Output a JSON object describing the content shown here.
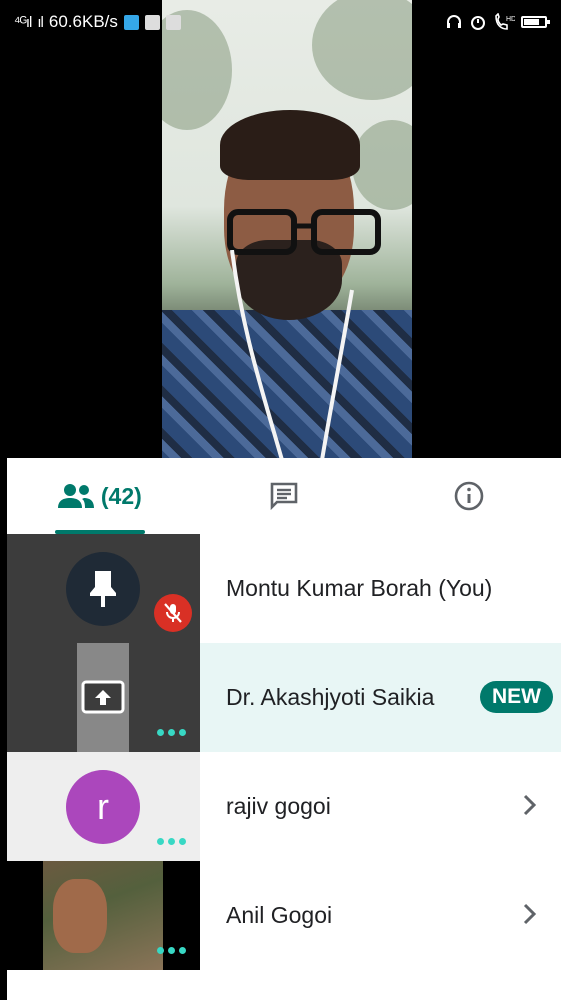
{
  "status_bar": {
    "signal_1": "⁴ᴳıl",
    "signal_2": "ıl",
    "speed": "60.6KB/s"
  },
  "tabs": {
    "people_count": "(42)",
    "items": [
      {
        "icon": "people-icon"
      },
      {
        "icon": "chat-icon"
      },
      {
        "icon": "info-icon"
      }
    ]
  },
  "participants": [
    {
      "name": "Montu Kumar Borah (You)",
      "muted": true
    },
    {
      "name": "Dr. Akashjyoti Saikia",
      "badge": "NEW",
      "presenting": true
    },
    {
      "name": "rajiv gogoi",
      "avatar_letter": "r",
      "avatar_color": "#ab47bc"
    },
    {
      "name": "Anil Gogoi"
    }
  ],
  "colors": {
    "accent": "#00796b",
    "highlight_row": "#e8f6f5",
    "mute_red": "#d93025",
    "dots_teal": "#38d8c4"
  }
}
